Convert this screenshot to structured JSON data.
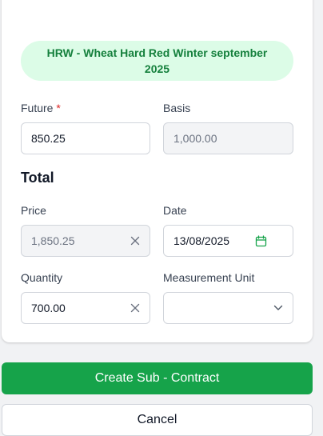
{
  "banner": {
    "text": "HRW - Wheat Hard Red Winter september 2025"
  },
  "future": {
    "label": "Future",
    "required_mark": "*",
    "value": "850.25"
  },
  "basis": {
    "label": "Basis",
    "value": "1,000.00"
  },
  "total": {
    "title": "Total"
  },
  "price": {
    "label": "Price",
    "value": "1,850.25",
    "clear_icon": "close-icon"
  },
  "date": {
    "label": "Date",
    "value": "13/08/2025",
    "icon": "calendar-icon"
  },
  "quantity": {
    "label": "Quantity",
    "value": "700.00",
    "clear_icon": "close-icon"
  },
  "measurement_unit": {
    "label": "Measurement Unit",
    "value": "",
    "icon": "chevron-down-icon"
  },
  "actions": {
    "create_label": "Create Sub - Contract",
    "cancel_label": "Cancel"
  },
  "colors": {
    "primary": "#16a34a",
    "banner_bg": "#dcfce7",
    "banner_text": "#15803d",
    "required": "#dc2626"
  }
}
